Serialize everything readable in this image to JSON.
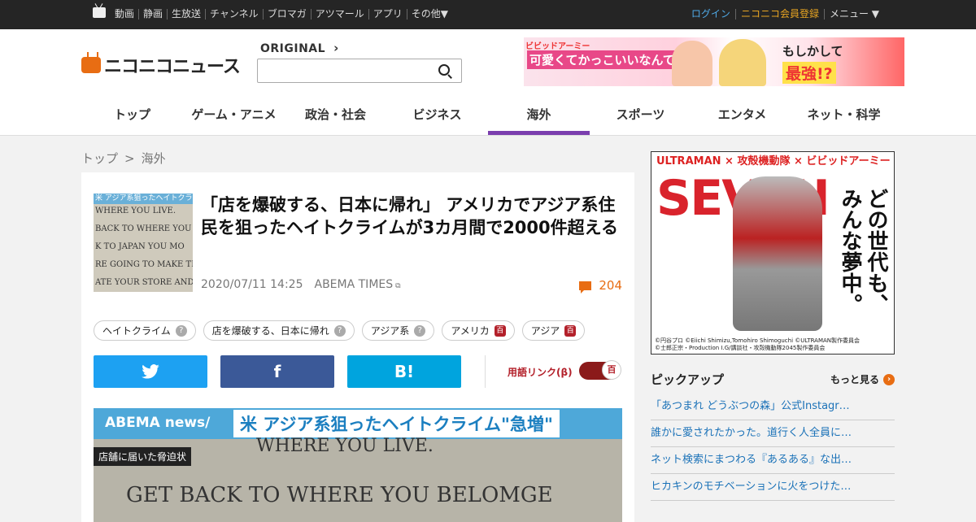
{
  "topbar": {
    "nav": [
      "動画",
      "静画",
      "生放送",
      "チャンネル",
      "ブロマガ",
      "アツマール",
      "アプリ",
      "その他▼"
    ],
    "login": "ログイン",
    "register": "ニコニコ会員登録",
    "menu": "メニュー ▼"
  },
  "header": {
    "brand": "ニコニコニュース",
    "original": "ORIGINAL",
    "search_placeholder": "",
    "banner": {
      "line1": "ビビッドアーミー",
      "line2": "可愛くてかっこいいなんて",
      "line3": "もしかして",
      "line4": "最強!?"
    }
  },
  "categories": [
    "トップ",
    "ゲーム・アニメ",
    "政治・社会",
    "ビジネス",
    "海外",
    "スポーツ",
    "エンタメ",
    "ネット・科学"
  ],
  "active_category": "海外",
  "breadcrumb": [
    "トップ",
    "海外"
  ],
  "article": {
    "thumb_caption": "米 アジア系狙ったヘイトクライム",
    "thumb_lines": [
      "WHERE YOU LIVE.",
      "BACK TO WHERE YOU BE",
      "K TO JAPAN YOU MO",
      "RE GOING TO MAKE TH",
      "ATE YOUR STORE AND"
    ],
    "title": "「店を爆破する、日本に帰れ」 アメリカでアジア系住民を狙ったヘイトクライムが3カ月間で2000件超える",
    "date": "2020/07/11 14:25",
    "source": "ABEMA TIMES",
    "comments": "204",
    "tags": [
      {
        "label": "ヘイトクライム",
        "kind": "q"
      },
      {
        "label": "店を爆破する、日本に帰れ",
        "kind": "q"
      },
      {
        "label": "アジア系",
        "kind": "q"
      },
      {
        "label": "アメリカ",
        "kind": "d"
      },
      {
        "label": "アジア",
        "kind": "d"
      }
    ],
    "share": {
      "twitter": "twitter-icon",
      "facebook": "f",
      "hatena": "B!"
    },
    "term_link": "用語リンク(β)",
    "toggle_icon": "百",
    "photo": {
      "brand": "ABEMA news/",
      "caption": "米 アジア系狙ったヘイトクライム\"急増\"",
      "sub": "店舗に届いた脅迫状",
      "line1": "WHERE YOU LIVE.",
      "line2": "GET BACK TO WHERE YOU BELOMGE"
    }
  },
  "sidebar": {
    "ad": {
      "header": "ULTRAMAN × 攻殻機動隊 × ビビッドアーミー",
      "big": "SEVEN",
      "vertical": "どの世代も、みんな夢中。",
      "credit1": "©円谷プロ ©Eiichi Shimizu,Tomohiro Shimoguchi ©ULTRAMAN製作委員会",
      "credit2": "©士郎正宗・Production I.G/講談社・攻殻機動隊2045製作委員会"
    },
    "pickup_title": "ピックアップ",
    "more": "もっと見る",
    "pickup": [
      "「あつまれ どうぶつの森」公式Instagr…",
      "誰かに愛されたかった。道行く人全員に…",
      "ネット検索にまつわる『あるある』な出…",
      "ヒカキンのモチベーションに火をつけた…"
    ]
  }
}
